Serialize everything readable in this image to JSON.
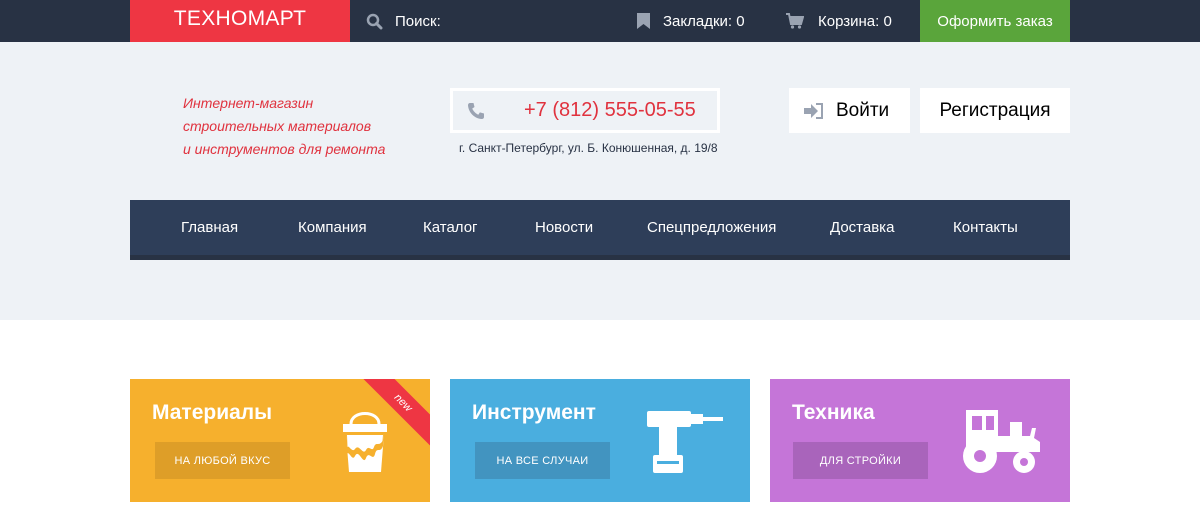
{
  "topbar": {
    "logo": "ТЕХНОМАРТ",
    "search_label": "Поиск:",
    "bookmarks_label": "Закладки: 0",
    "cart_label": "Корзина: 0",
    "order_button": "Оформить заказ"
  },
  "header": {
    "tagline": [
      "Интернет-магазин",
      "строительных материалов",
      "и инструментов для ремонта"
    ],
    "phone": "+7 (812) 555-05-55",
    "address": "г. Санкт-Петербург, ул. Б. Конюшенная, д. 19/8",
    "login_button": "Войти",
    "register_button": "Регистрация"
  },
  "nav": {
    "items": [
      {
        "label": "Главная"
      },
      {
        "label": "Компания"
      },
      {
        "label": "Каталог"
      },
      {
        "label": "Новости"
      },
      {
        "label": "Спецпредложения"
      },
      {
        "label": "Доставка"
      },
      {
        "label": "Контакты"
      }
    ]
  },
  "cards": [
    {
      "title": "Материалы",
      "button": "НА ЛЮБОЙ ВКУС",
      "icon": "paint-bucket-icon",
      "color": "#f6b02d",
      "button_color": "#de9e28",
      "badge": "new"
    },
    {
      "title": "Инструмент",
      "button": "НА ВСЕ СЛУЧАИ",
      "icon": "drill-icon",
      "color": "#4aaedf",
      "button_color": "#4294c0"
    },
    {
      "title": "Техника",
      "button": "ДЛЯ СТРОЙКИ",
      "icon": "tractor-icon",
      "color": "#c575d8",
      "button_color": "#a964bb"
    }
  ],
  "colors": {
    "accent": "#ee3643",
    "dark": "#283244",
    "nav": "#2e3e59",
    "success": "#5aa53b",
    "header_bg": "#eef2f6"
  }
}
